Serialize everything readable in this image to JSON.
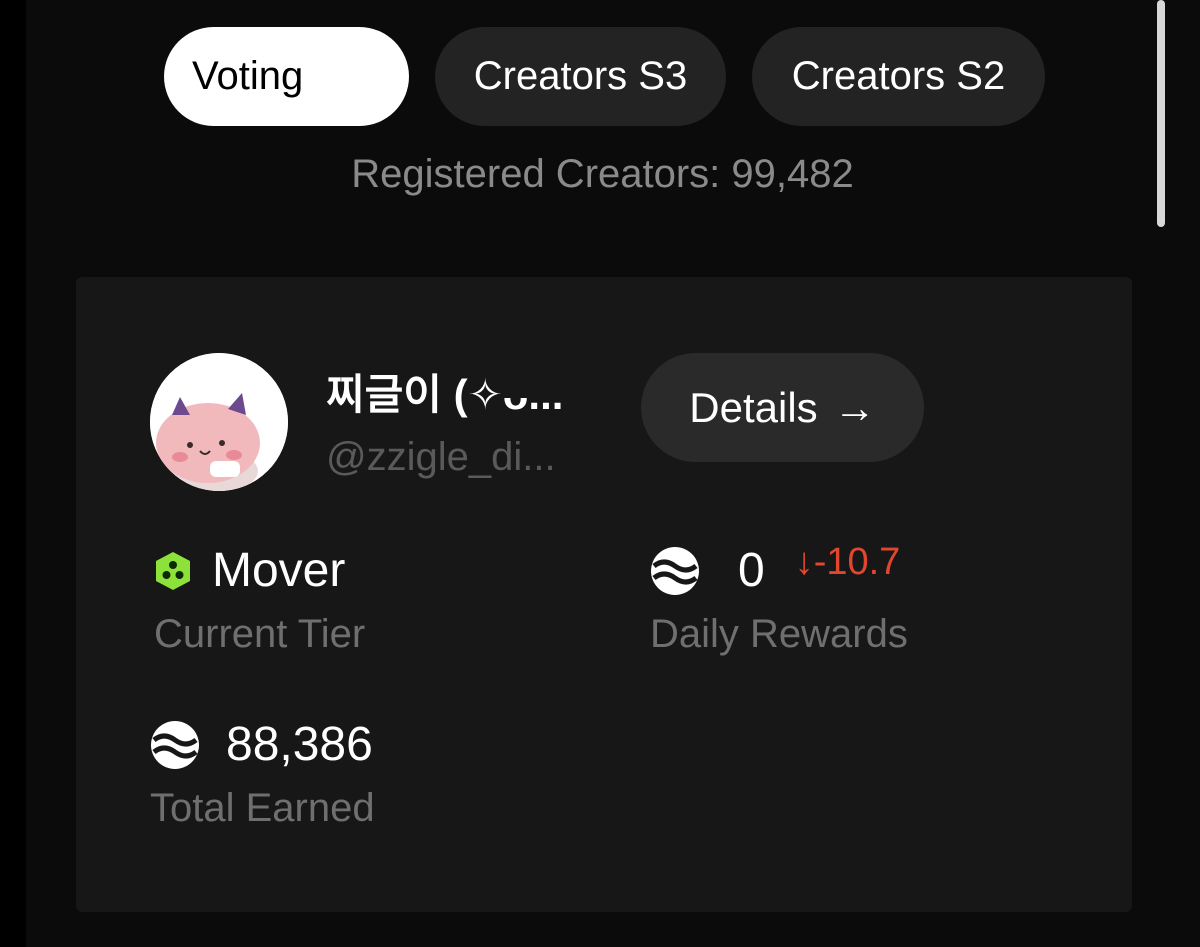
{
  "tabs": [
    {
      "label": "Voting",
      "active": true
    },
    {
      "label": "Creators S3",
      "active": false
    },
    {
      "label": "Creators S2",
      "active": false
    }
  ],
  "registered_text": "Registered Creators: 99,482",
  "creator": {
    "name": "찌글이 (✧ᴗ...",
    "handle": "@zzigle_di...",
    "details_label": "Details",
    "details_arrow": "→"
  },
  "stats": {
    "tier": {
      "value": "Mover",
      "label": "Current Tier",
      "icon": "tier-hexagon-icon"
    },
    "daily": {
      "value": "0",
      "delta": "↓-10.7",
      "label": "Daily Rewards",
      "icon": "sui-token-icon"
    },
    "total": {
      "value": "88,386",
      "label": "Total Earned",
      "icon": "sui-token-icon"
    }
  },
  "colors": {
    "background": "#0b0b0b",
    "card": "#171717",
    "tab_inactive": "#232323",
    "delta_negative": "#e0472e",
    "tier_green": "#8de23a"
  }
}
